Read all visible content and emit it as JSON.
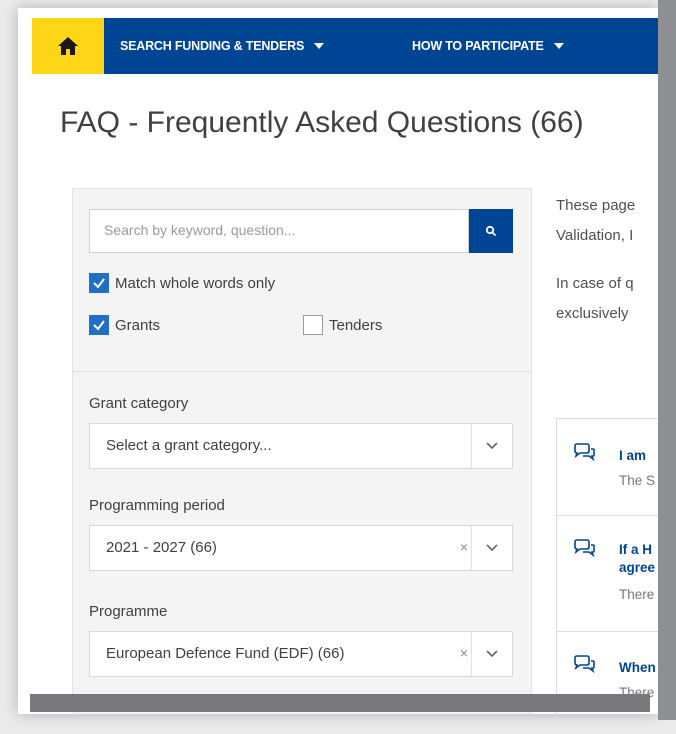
{
  "nav": {
    "items": [
      {
        "label": "SEARCH FUNDING & TENDERS"
      },
      {
        "label": "HOW TO PARTICIPATE"
      }
    ],
    "accent": "#ffd617",
    "brand": "#004494"
  },
  "page": {
    "title": "FAQ - Frequently Asked Questions (66)"
  },
  "filters": {
    "search_placeholder": "Search by keyword, question...",
    "match_whole_words": {
      "label": "Match whole words only",
      "checked": true
    },
    "grants": {
      "label": "Grants",
      "checked": true
    },
    "tenders": {
      "label": "Tenders",
      "checked": false
    },
    "grant_category": {
      "label": "Grant category",
      "value": "Select a grant category..."
    },
    "programming_period": {
      "label": "Programming period",
      "value": "2021 - 2027 (66)"
    },
    "programme": {
      "label": "Programme",
      "value": "European Defence Fund (EDF) (66)"
    }
  },
  "intro": {
    "line1": "These page",
    "line2": "Validation, I",
    "line3": "In case of q",
    "line4": "exclusively "
  },
  "faq": [
    {
      "title_lines": [
        "I am"
      ],
      "answer": "The S"
    },
    {
      "title_lines": [
        "If a H",
        "agree"
      ],
      "answer": "There"
    },
    {
      "title_lines": [
        "When"
      ],
      "answer": "There"
    }
  ],
  "icons": [
    "home-icon",
    "search-icon",
    "chevron-down-icon",
    "clear-icon",
    "question-bubble-icon",
    "check-icon"
  ]
}
